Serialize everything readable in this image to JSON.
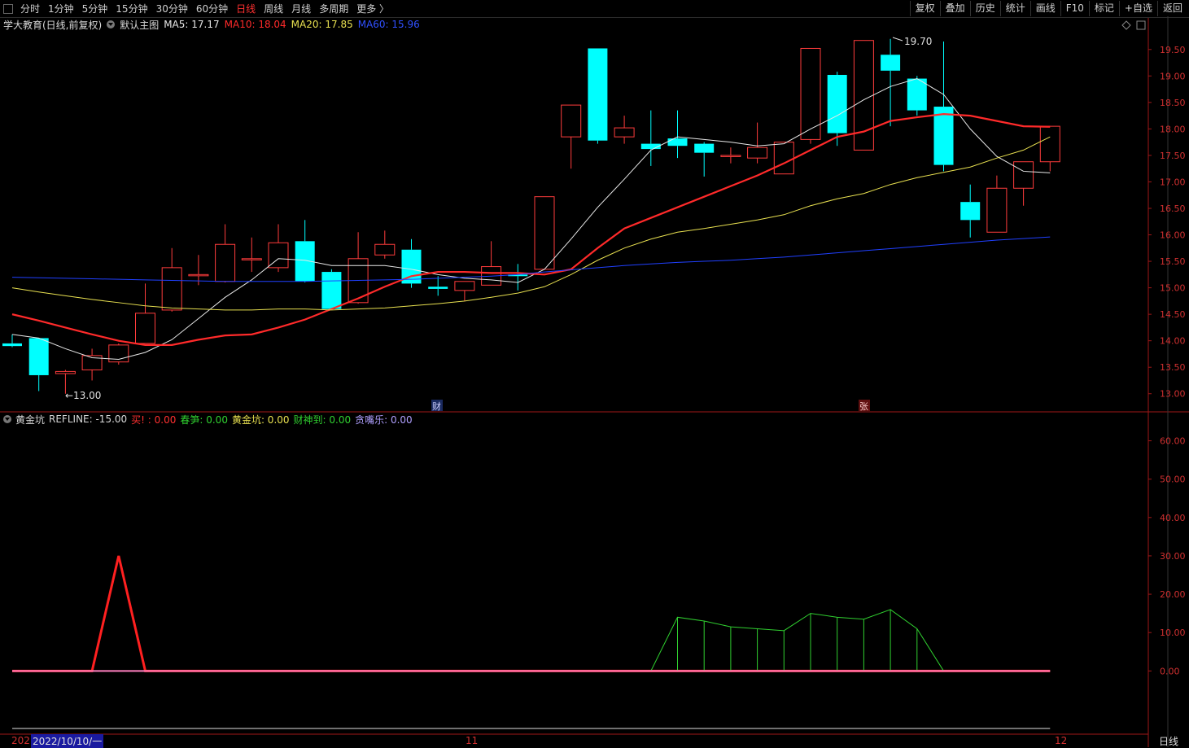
{
  "toolbar": {
    "periods": [
      "分时",
      "1分钟",
      "5分钟",
      "15分钟",
      "30分钟",
      "60分钟",
      "日线",
      "周线",
      "月线",
      "多周期",
      "更多 〉"
    ],
    "active_period_index": 6,
    "tools": [
      "复权",
      "叠加",
      "历史",
      "统计",
      "画线",
      "F10",
      "标记",
      "+自选",
      "返回"
    ]
  },
  "main_header": {
    "title": "学大教育(日线,前复权)",
    "template": "默认主图",
    "ma5": "MA5: 17.17",
    "ma10": "MA10: 18.04",
    "ma20": "MA20: 17.85",
    "ma60": "MA60: 15.96",
    "ma5_color": "#e8e8e8",
    "ma10_color": "#ff2a2a",
    "ma20_color": "#e8e050",
    "ma60_color": "#2040ff"
  },
  "indicator_header": {
    "name": "黄金坑",
    "refline": "REFLINE: -15.00",
    "buy": "买! : 0.00",
    "chunsun": "春笋: 0.00",
    "huangjinkeng": "黄金坑: 0.00",
    "caishendao": "财神到: 0.00",
    "tanzuile": "贪嘴乐: 0.00"
  },
  "annotations": {
    "low_label": "←13.00",
    "high_label": "19.70",
    "marker_cai": "财",
    "marker_zhang": "张"
  },
  "bottom_axis": {
    "left_year": "202",
    "cursor_date": "2022/10/10/一",
    "month_11": "11",
    "month_12": "12",
    "period_label": "日线"
  },
  "chart_data": [
    {
      "type": "candlestick",
      "title": "学大教育(日线,前复权)",
      "ylim": [
        12.75,
        19.85
      ],
      "y_ticks": [
        13.0,
        13.5,
        14.0,
        14.5,
        15.0,
        15.5,
        16.0,
        16.5,
        17.0,
        17.5,
        18.0,
        18.5,
        19.0,
        19.5
      ],
      "y_tick_labels": [
        "13.00",
        "13.50",
        "14.00",
        "14.50",
        "15.00",
        "15.50",
        "16.00",
        "16.50",
        "17.00",
        "17.50",
        "18.00",
        "18.50",
        "19.00",
        "19.50"
      ],
      "candles": [
        {
          "o": 13.95,
          "h": 14.12,
          "l": 13.88,
          "c": 13.9
        },
        {
          "o": 14.05,
          "h": 14.05,
          "l": 13.05,
          "c": 13.35
        },
        {
          "o": 13.38,
          "h": 13.45,
          "l": 13.0,
          "c": 13.42
        },
        {
          "o": 13.45,
          "h": 13.85,
          "l": 13.25,
          "c": 13.72
        },
        {
          "o": 13.6,
          "h": 13.95,
          "l": 13.55,
          "c": 13.92
        },
        {
          "o": 13.95,
          "h": 15.08,
          "l": 13.95,
          "c": 14.52
        },
        {
          "o": 14.58,
          "h": 15.75,
          "l": 14.55,
          "c": 15.38
        },
        {
          "o": 15.25,
          "h": 15.62,
          "l": 15.05,
          "c": 15.25
        },
        {
          "o": 15.12,
          "h": 16.2,
          "l": 15.1,
          "c": 15.82
        },
        {
          "o": 15.55,
          "h": 15.95,
          "l": 15.3,
          "c": 15.55
        },
        {
          "o": 15.38,
          "h": 16.2,
          "l": 15.3,
          "c": 15.85
        },
        {
          "o": 15.88,
          "h": 16.28,
          "l": 15.1,
          "c": 15.12
        },
        {
          "o": 15.3,
          "h": 15.35,
          "l": 14.58,
          "c": 14.6
        },
        {
          "o": 14.72,
          "h": 16.05,
          "l": 14.7,
          "c": 15.55
        },
        {
          "o": 15.62,
          "h": 16.08,
          "l": 15.55,
          "c": 15.82
        },
        {
          "o": 15.72,
          "h": 15.92,
          "l": 15.0,
          "c": 15.08
        },
        {
          "o": 15.02,
          "h": 15.22,
          "l": 14.85,
          "c": 14.98
        },
        {
          "o": 14.95,
          "h": 15.12,
          "l": 14.75,
          "c": 15.12
        },
        {
          "o": 15.05,
          "h": 15.88,
          "l": 15.05,
          "c": 15.4
        },
        {
          "o": 15.25,
          "h": 15.45,
          "l": 14.95,
          "c": 15.22
        },
        {
          "o": 15.35,
          "h": 16.72,
          "l": 15.35,
          "c": 16.72
        },
        {
          "o": 17.85,
          "h": 18.45,
          "l": 17.25,
          "c": 18.45
        },
        {
          "o": 19.52,
          "h": 19.52,
          "l": 17.72,
          "c": 17.78
        },
        {
          "o": 17.85,
          "h": 18.25,
          "l": 17.72,
          "c": 18.02
        },
        {
          "o": 17.72,
          "h": 18.35,
          "l": 17.3,
          "c": 17.62
        },
        {
          "o": 17.82,
          "h": 18.35,
          "l": 17.45,
          "c": 17.68
        },
        {
          "o": 17.72,
          "h": 17.75,
          "l": 17.1,
          "c": 17.55
        },
        {
          "o": 17.5,
          "h": 17.65,
          "l": 17.35,
          "c": 17.5
        },
        {
          "o": 17.45,
          "h": 18.12,
          "l": 17.35,
          "c": 17.65
        },
        {
          "o": 17.15,
          "h": 17.75,
          "l": 17.15,
          "c": 17.75
        },
        {
          "o": 17.8,
          "h": 19.52,
          "l": 17.72,
          "c": 19.52
        },
        {
          "o": 19.02,
          "h": 19.08,
          "l": 17.68,
          "c": 17.92
        },
        {
          "o": 17.6,
          "h": 19.67,
          "l": 17.6,
          "c": 19.67
        },
        {
          "o": 19.4,
          "h": 19.7,
          "l": 18.05,
          "c": 19.1
        },
        {
          "o": 18.95,
          "h": 19.0,
          "l": 18.25,
          "c": 18.35
        },
        {
          "o": 18.42,
          "h": 19.65,
          "l": 17.2,
          "c": 17.32
        },
        {
          "o": 16.62,
          "h": 16.95,
          "l": 15.95,
          "c": 16.28
        },
        {
          "o": 16.05,
          "h": 17.12,
          "l": 16.05,
          "c": 16.88
        },
        {
          "o": 16.88,
          "h": 17.38,
          "l": 16.55,
          "c": 17.38
        },
        {
          "o": 17.38,
          "h": 18.05,
          "l": 17.2,
          "c": 18.05
        }
      ],
      "series": [
        {
          "name": "MA5",
          "values": [
            14.12,
            14.05,
            13.85,
            13.68,
            13.65,
            13.78,
            14.02,
            14.42,
            14.82,
            15.15,
            15.55,
            15.52,
            15.42,
            15.42,
            15.42,
            15.35,
            15.25,
            15.18,
            15.15,
            15.1,
            15.35,
            15.92,
            16.52,
            17.05,
            17.6,
            17.85,
            17.8,
            17.75,
            17.68,
            17.72,
            18.0,
            18.25,
            18.55,
            18.8,
            18.95,
            18.65,
            18.0,
            17.48,
            17.2,
            17.17
          ]
        },
        {
          "name": "MA10",
          "values": [
            14.5,
            14.38,
            14.25,
            14.12,
            14.0,
            13.92,
            13.92,
            14.02,
            14.1,
            14.12,
            14.25,
            14.4,
            14.6,
            14.8,
            15.02,
            15.22,
            15.3,
            15.3,
            15.28,
            15.28,
            15.25,
            15.35,
            15.75,
            16.12,
            16.32,
            16.52,
            16.72,
            16.92,
            17.12,
            17.35,
            17.6,
            17.85,
            17.95,
            18.15,
            18.22,
            18.28,
            18.25,
            18.15,
            18.05,
            18.04
          ]
        },
        {
          "name": "MA20",
          "values": [
            15.0,
            14.92,
            14.85,
            14.78,
            14.72,
            14.66,
            14.62,
            14.6,
            14.58,
            14.58,
            14.6,
            14.6,
            14.58,
            14.6,
            14.62,
            14.66,
            14.7,
            14.75,
            14.82,
            14.9,
            15.02,
            15.25,
            15.52,
            15.75,
            15.92,
            16.05,
            16.12,
            16.2,
            16.28,
            16.38,
            16.55,
            16.68,
            16.78,
            16.95,
            17.08,
            17.18,
            17.28,
            17.45,
            17.6,
            17.85
          ]
        },
        {
          "name": "MA60",
          "values": [
            15.2,
            15.19,
            15.18,
            15.17,
            15.16,
            15.15,
            15.14,
            15.13,
            15.12,
            15.12,
            15.12,
            15.12,
            15.13,
            15.14,
            15.15,
            15.16,
            15.18,
            15.2,
            15.22,
            15.25,
            15.3,
            15.34,
            15.38,
            15.42,
            15.45,
            15.48,
            15.5,
            15.52,
            15.55,
            15.58,
            15.62,
            15.66,
            15.7,
            15.74,
            15.78,
            15.82,
            15.86,
            15.9,
            15.93,
            15.96
          ]
        }
      ]
    },
    {
      "type": "line",
      "title": "黄金坑",
      "ylim": [
        -15,
        65
      ],
      "y_ticks": [
        0,
        10,
        20,
        30,
        40,
        50,
        60
      ],
      "y_tick_labels": [
        "0.00",
        "10.00",
        "20.00",
        "30.00",
        "40.00",
        "50.00",
        "60.00"
      ],
      "series": [
        {
          "name": "买!",
          "color": "#ff2020",
          "values": [
            0,
            0,
            0,
            0,
            30,
            0,
            0,
            0,
            0,
            0,
            0,
            0,
            0,
            0,
            0,
            0,
            0,
            0,
            0,
            0,
            0,
            0,
            0,
            0,
            0,
            0,
            0,
            0,
            0,
            0,
            0,
            0,
            0,
            0,
            0,
            0,
            0,
            0,
            0,
            0
          ]
        },
        {
          "name": "春笋",
          "color": "#30d030",
          "values": [
            0,
            0,
            0,
            0,
            0,
            0,
            0,
            0,
            0,
            0,
            0,
            0,
            0,
            0,
            0,
            0,
            0,
            0,
            0,
            0,
            0,
            0,
            0,
            0,
            0,
            14,
            13,
            11.5,
            11,
            10.5,
            15,
            14,
            13.5,
            16,
            11,
            0,
            0,
            0,
            0,
            0
          ]
        },
        {
          "name": "贪嘴乐",
          "color": "#ff80c0",
          "values": [
            0,
            0,
            0,
            0,
            0,
            0,
            0,
            0,
            0,
            0,
            0,
            0,
            0,
            0,
            0,
            0,
            0,
            0,
            0,
            0,
            0,
            0,
            0,
            0,
            0,
            0,
            0,
            0,
            0,
            0,
            0,
            0,
            0,
            0,
            0,
            0,
            0,
            0,
            0,
            0
          ]
        },
        {
          "name": "REFLINE",
          "color": "#e0e0e0",
          "values": [
            -15,
            -15,
            -15,
            -15,
            -15,
            -15,
            -15,
            -15,
            -15,
            -15,
            -15,
            -15,
            -15,
            -15,
            -15,
            -15,
            -15,
            -15,
            -15,
            -15,
            -15,
            -15,
            -15,
            -15,
            -15,
            -15,
            -15,
            -15,
            -15,
            -15,
            -15,
            -15,
            -15,
            -15,
            -15,
            -15,
            -15,
            -15,
            -15,
            -15
          ]
        }
      ]
    }
  ]
}
